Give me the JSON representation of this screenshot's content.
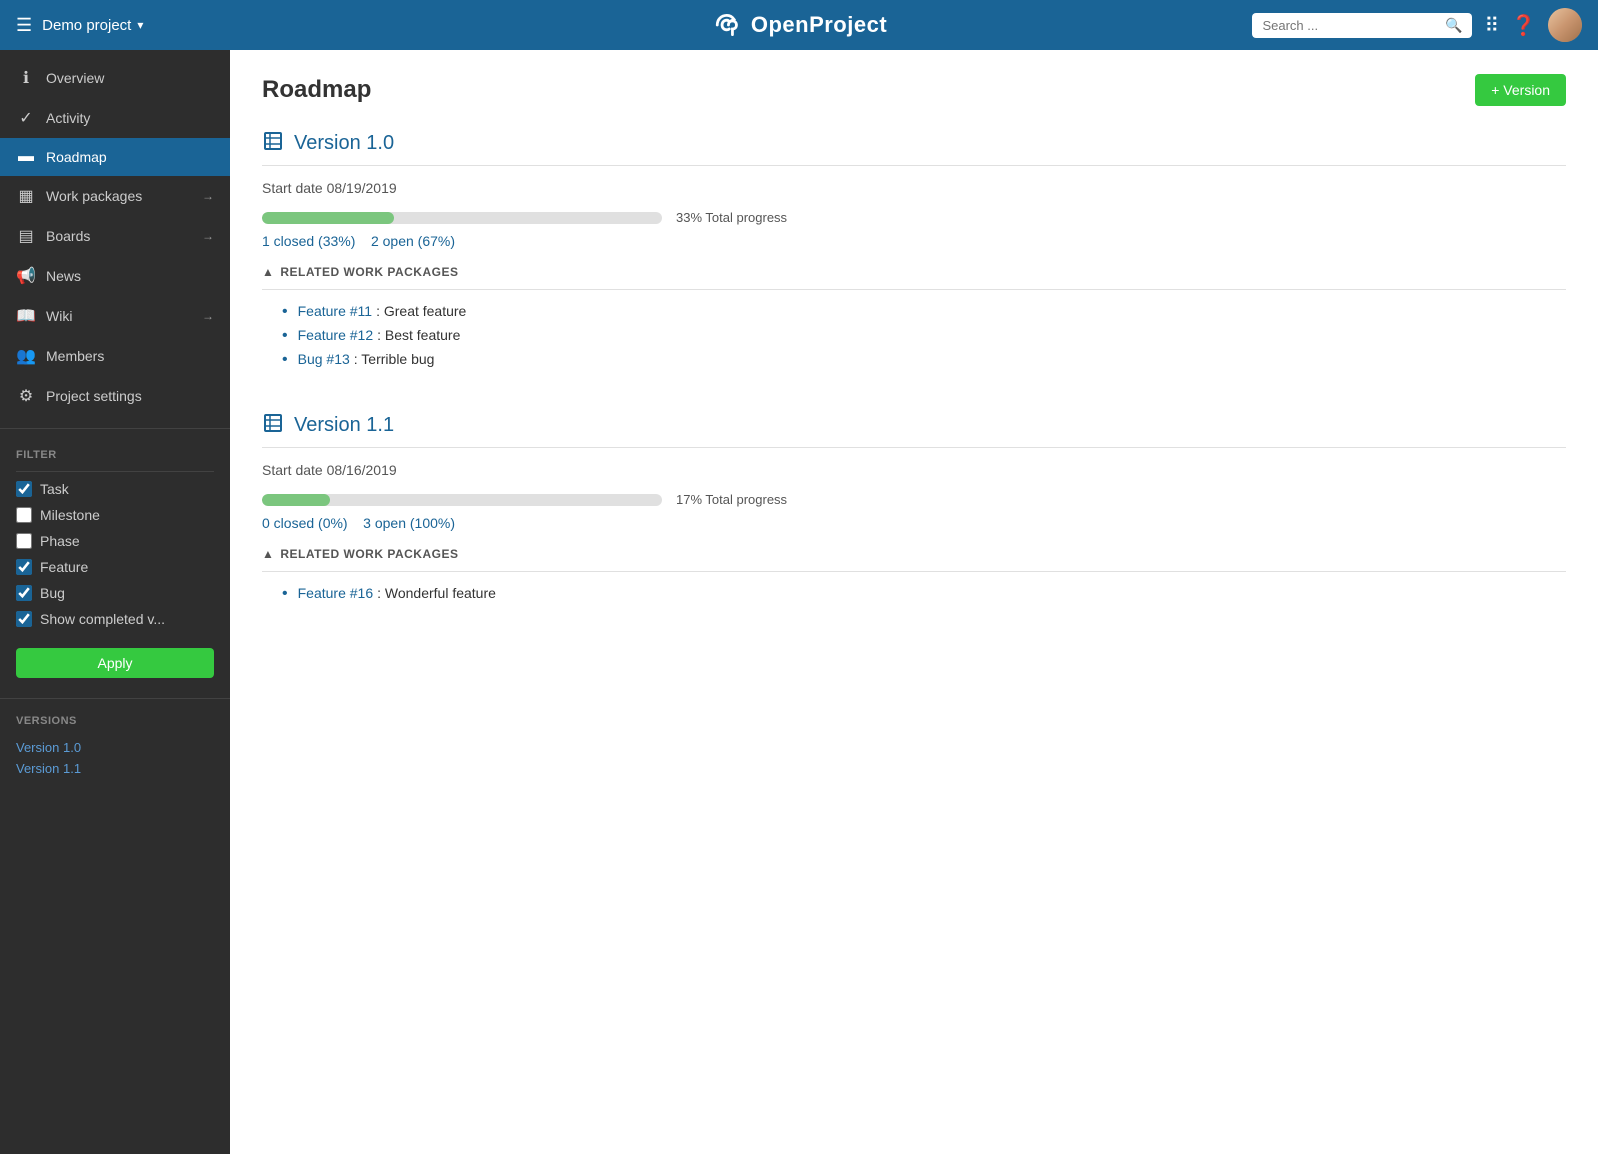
{
  "topnav": {
    "hamburger": "☰",
    "project_name": "Demo project",
    "project_arrow": "▾",
    "logo_text": "OpenProject",
    "search_placeholder": "Search ...",
    "add_version_label": "+ Version"
  },
  "sidebar": {
    "items": [
      {
        "id": "overview",
        "icon": "ℹ",
        "label": "Overview",
        "arrow": ""
      },
      {
        "id": "activity",
        "icon": "✓",
        "label": "Activity",
        "arrow": ""
      },
      {
        "id": "roadmap",
        "icon": "▬",
        "label": "Roadmap",
        "arrow": "",
        "active": true
      },
      {
        "id": "workpackages",
        "icon": "▦",
        "label": "Work packages",
        "arrow": "→"
      },
      {
        "id": "boards",
        "icon": "▤",
        "label": "Boards",
        "arrow": "→"
      },
      {
        "id": "news",
        "icon": "📢",
        "label": "News",
        "arrow": ""
      },
      {
        "id": "wiki",
        "icon": "📖",
        "label": "Wiki",
        "arrow": "→"
      },
      {
        "id": "members",
        "icon": "👥",
        "label": "Members",
        "arrow": ""
      },
      {
        "id": "projectsettings",
        "icon": "⚙",
        "label": "Project settings",
        "arrow": ""
      }
    ],
    "filter": {
      "title": "FILTER",
      "items": [
        {
          "id": "task",
          "label": "Task",
          "checked": true
        },
        {
          "id": "milestone",
          "label": "Milestone",
          "checked": false
        },
        {
          "id": "phase",
          "label": "Phase",
          "checked": false
        },
        {
          "id": "feature",
          "label": "Feature",
          "checked": true
        },
        {
          "id": "bug",
          "label": "Bug",
          "checked": true
        },
        {
          "id": "showcompleted",
          "label": "Show completed v...",
          "checked": true
        }
      ],
      "apply_label": "Apply"
    },
    "versions": {
      "title": "VERSIONS",
      "items": [
        {
          "label": "Version 1.0"
        },
        {
          "label": "Version 1.1"
        }
      ]
    }
  },
  "main": {
    "page_title": "Roadmap",
    "versions": [
      {
        "id": "v10",
        "title": "Version 1.0",
        "start_date_label": "Start date 08/19/2019",
        "progress_percent": 33,
        "progress_label": "33% Total progress",
        "closed_count": "1 closed (33%)",
        "open_count": "2 open (67%)",
        "related_header": "RELATED WORK PACKAGES",
        "work_packages": [
          {
            "link": "Feature #11",
            "desc": ": Great feature"
          },
          {
            "link": "Feature #12",
            "desc": ": Best feature"
          },
          {
            "link": "Bug #13",
            "desc": ": Terrible bug"
          }
        ]
      },
      {
        "id": "v11",
        "title": "Version 1.1",
        "start_date_label": "Start date 08/16/2019",
        "progress_percent": 17,
        "progress_label": "17% Total progress",
        "closed_count": "0 closed (0%)",
        "open_count": "3 open (100%)",
        "related_header": "RELATED WORK PACKAGES",
        "work_packages": [
          {
            "link": "Feature #16",
            "desc": ": Wonderful feature"
          }
        ]
      }
    ]
  }
}
